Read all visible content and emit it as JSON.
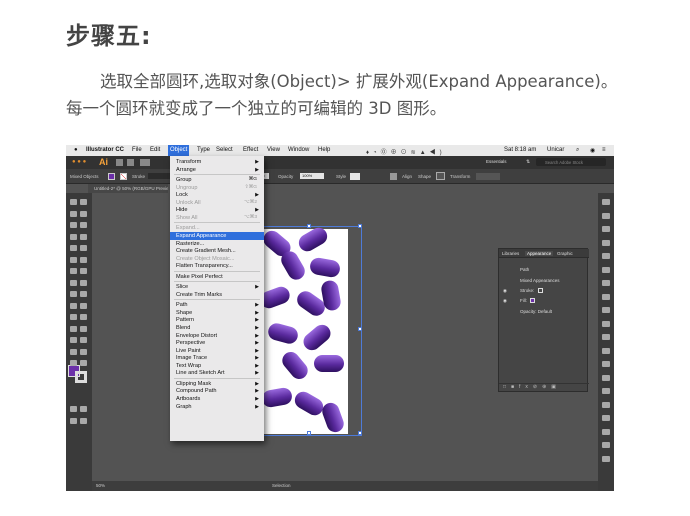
{
  "heading": "步骤五:",
  "paragraph": "选取全部圆环,选取对象(Object)> 扩展外观(Expand Appearance)。每一个圆环就变成了一个独立的可编辑的 3D 图形。",
  "macmenu": {
    "apple": "",
    "app": "Illustrator CC",
    "items": [
      "File",
      "Edit",
      "Object",
      "Type",
      "Select",
      "Effect",
      "View",
      "Window",
      "Help"
    ],
    "active": "Object",
    "clock": "Sat 8:18 am",
    "user": "Unicar"
  },
  "appbar": {
    "logo": "Ai",
    "workspace": "Essentials",
    "search_placeholder": "Search Adobe Stock"
  },
  "control_bar": {
    "selection": "Mixed Objects",
    "stroke_label": "Stroke",
    "stroke_value": "Basic",
    "opacity_label": "Opacity",
    "opacity_value": "100%",
    "style_label": "Style",
    "align_label": "Align",
    "shape_label": "Shape",
    "transform_label": "Transform"
  },
  "document_tab": "Untitled-2* @ 50% (RGB/GPU Preview)",
  "object_menu": [
    {
      "label": "Transform",
      "arrow": true
    },
    {
      "label": "Arrange",
      "arrow": true
    },
    {
      "sep": true
    },
    {
      "label": "Group",
      "shortcut": "⌘G"
    },
    {
      "label": "Ungroup",
      "shortcut": "⇧⌘G",
      "disabled": true
    },
    {
      "label": "Lock",
      "arrow": true
    },
    {
      "label": "Unlock All",
      "shortcut": "⌥⌘2",
      "disabled": true
    },
    {
      "label": "Hide",
      "arrow": true
    },
    {
      "label": "Show All",
      "shortcut": "⌥⌘3",
      "disabled": true
    },
    {
      "sep": true
    },
    {
      "label": "Expand...",
      "disabled": true
    },
    {
      "label": "Expand Appearance",
      "highlight": true
    },
    {
      "label": "Rasterize..."
    },
    {
      "label": "Create Gradient Mesh..."
    },
    {
      "label": "Create Object Mosaic...",
      "disabled": true
    },
    {
      "label": "Flatten Transparency..."
    },
    {
      "sep": true
    },
    {
      "label": "Make Pixel Perfect"
    },
    {
      "sep": true
    },
    {
      "label": "Slice",
      "arrow": true
    },
    {
      "label": "Create Trim Marks"
    },
    {
      "sep": true
    },
    {
      "label": "Path",
      "arrow": true
    },
    {
      "label": "Shape",
      "arrow": true
    },
    {
      "label": "Pattern",
      "arrow": true
    },
    {
      "label": "Blend",
      "arrow": true
    },
    {
      "label": "Envelope Distort",
      "arrow": true
    },
    {
      "label": "Perspective",
      "arrow": true
    },
    {
      "label": "Live Paint",
      "arrow": true
    },
    {
      "label": "Image Trace",
      "arrow": true
    },
    {
      "label": "Text Wrap",
      "arrow": true
    },
    {
      "label": "Line and Sketch Art",
      "arrow": true
    },
    {
      "sep": true
    },
    {
      "label": "Clipping Mask",
      "arrow": true
    },
    {
      "label": "Compound Path",
      "arrow": true
    },
    {
      "label": "Artboards",
      "arrow": true
    },
    {
      "label": "Graph",
      "arrow": true
    }
  ],
  "appearance_panel": {
    "tabs": [
      "Libraries",
      "Appearance",
      "Graphic"
    ],
    "active_tab": "Appearance",
    "header": "Path",
    "rows": [
      "Mixed Appearances",
      "Stroke:",
      "Fill:",
      "Opacity: Default"
    ]
  },
  "statusbar": {
    "zoom": "50%",
    "tool": "Selection"
  },
  "colors": {
    "fill": "#6b2fa8",
    "highlight": "#2f6fdc"
  }
}
